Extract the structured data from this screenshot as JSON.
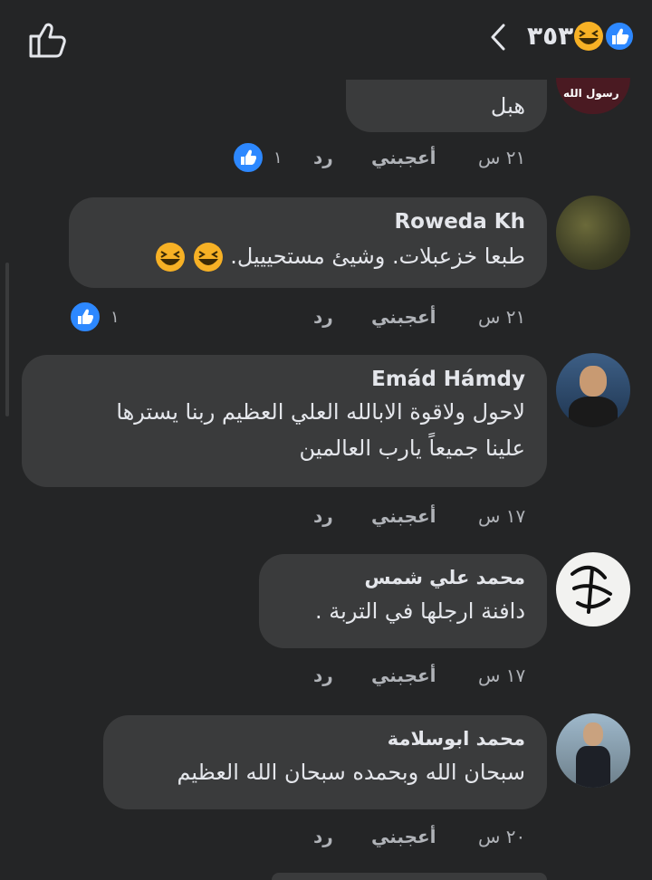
{
  "header": {
    "reaction_count": "٣٥٣",
    "icons": [
      "thumbs-up-outline-icon",
      "back-chevron-icon",
      "laugh-reaction-icon",
      "like-reaction-icon"
    ]
  },
  "comments": [
    {
      "author": "",
      "avatar_label": "رسول الله",
      "text": "هبل",
      "time": "٢١ س",
      "like": "أعجبني",
      "reply": "رد",
      "reaction_count": "١"
    },
    {
      "author": "Roweda Kh",
      "text": "طبعا خزعبلات. وشيئ مستحيييل.",
      "emojis": [
        "laughing-emoji",
        "laughing-emoji"
      ],
      "time": "٢١ س",
      "like": "أعجبني",
      "reply": "رد",
      "reaction_count": "١"
    },
    {
      "author": "Emád Hámdy",
      "text_line1": "لاحول ولاقوة الابالله العلي العظيم ربنا يسترها",
      "text_line2": "علينا جميعاً يارب العالمين",
      "time": "١٧ س",
      "like": "أعجبني",
      "reply": "رد"
    },
    {
      "author": "محمد علي شمس",
      "text": "دافنة ارجلها في التربة .",
      "time": "١٧ س",
      "like": "أعجبني",
      "reply": "رد"
    },
    {
      "author": "محمد ابوسلامة",
      "text": "سبحان الله وبحمده سبحان الله العظيم",
      "time": "٢٠ س",
      "like": "أعجبني",
      "reply": "رد"
    }
  ],
  "colors": {
    "background": "#242526",
    "bubble": "#3a3b3c",
    "meta_text": "#b0b3b8",
    "like_blue": "#2d88ff",
    "emoji_yellow": "#f7b125"
  }
}
